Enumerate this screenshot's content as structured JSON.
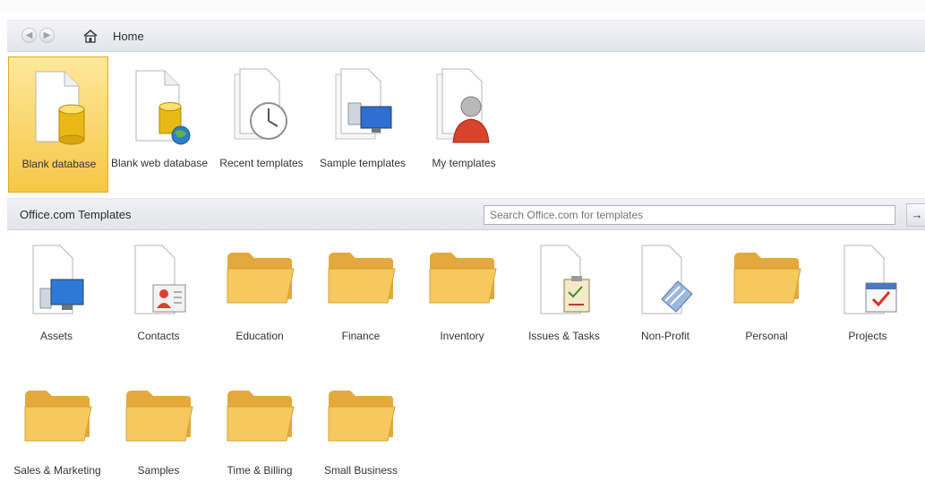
{
  "nav": {
    "back_icon": "back-arrow-icon",
    "forward_icon": "forward-arrow-icon",
    "home_label": "Home"
  },
  "top_items": [
    {
      "label": "Blank database",
      "icon": "blank-database-icon",
      "selected": true
    },
    {
      "label": "Blank web database",
      "icon": "blank-web-database-icon"
    },
    {
      "label": "Recent templates",
      "icon": "recent-templates-icon"
    },
    {
      "label": "Sample templates",
      "icon": "sample-templates-icon"
    },
    {
      "label": "My templates",
      "icon": "my-templates-icon"
    }
  ],
  "office_section": {
    "title": "Office.com Templates",
    "search_placeholder": "Search Office.com for templates",
    "search_go": "→"
  },
  "office_items": [
    {
      "label": "Assets",
      "icon": "assets-icon"
    },
    {
      "label": "Contacts",
      "icon": "contacts-icon"
    },
    {
      "label": "Education",
      "icon": "folder-icon"
    },
    {
      "label": "Finance",
      "icon": "folder-icon"
    },
    {
      "label": "Inventory",
      "icon": "folder-icon"
    },
    {
      "label": "Issues & Tasks",
      "icon": "issues-tasks-icon"
    },
    {
      "label": "Non-Profit",
      "icon": "non-profit-icon"
    },
    {
      "label": "Personal",
      "icon": "folder-icon"
    },
    {
      "label": "Projects",
      "icon": "projects-icon"
    },
    {
      "label": "Sales & Marketing",
      "icon": "folder-icon"
    },
    {
      "label": "Samples",
      "icon": "folder-icon"
    },
    {
      "label": "Time & Billing",
      "icon": "folder-icon"
    },
    {
      "label": "Small Business",
      "icon": "folder-icon"
    }
  ],
  "colors": {
    "selected_fill": "#f6c746",
    "folder": "#f3c55a",
    "bar": "#e3e6ea"
  }
}
